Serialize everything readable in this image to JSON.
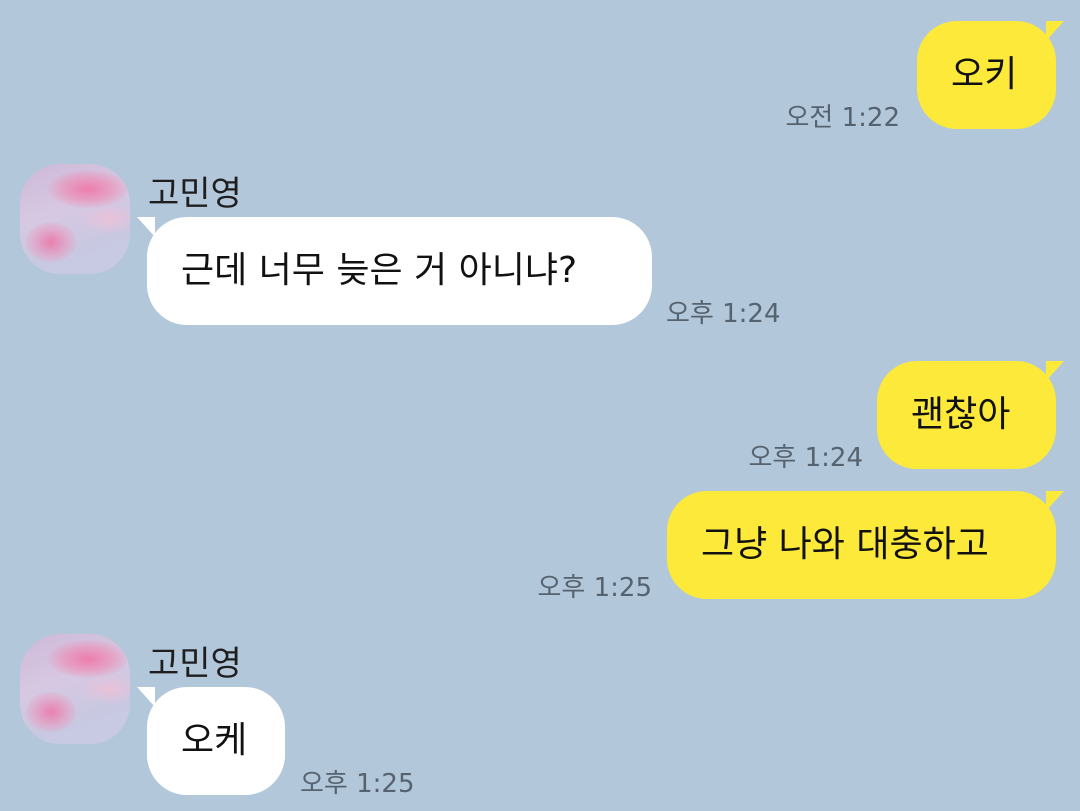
{
  "chat": {
    "messages": [
      {
        "sender": "me",
        "text": "오키",
        "time": "오전 1:22"
      },
      {
        "sender": "other",
        "name": "고민영",
        "text": "근데 너무 늦은 거 아니냐?",
        "time": "오후 1:24"
      },
      {
        "sender": "me",
        "text": "괜찮아",
        "time": "오후 1:24"
      },
      {
        "sender": "me",
        "text": "그냥 나와 대충하고",
        "time": "오후 1:25"
      },
      {
        "sender": "other",
        "name": "고민영",
        "text": "오케",
        "time": "오후 1:25"
      }
    ]
  },
  "colors": {
    "background": "#b2c7da",
    "my_bubble": "#fde93a",
    "their_bubble": "#ffffff",
    "timestamp": "#556270"
  },
  "icons": {
    "profile_avatar": "avatar-pink-cloud"
  }
}
